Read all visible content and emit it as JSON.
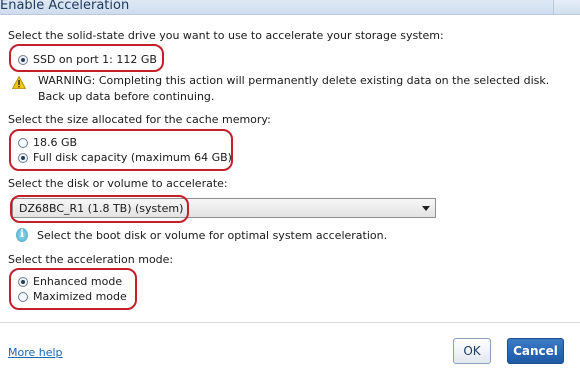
{
  "window": {
    "title": "Enable Acceleration"
  },
  "ssd_section": {
    "label": "Select the solid-state drive you want to use to accelerate your storage system:",
    "option": "SSD on port 1: 112 GB"
  },
  "warning": {
    "icon": "warning-triangle-icon",
    "text": "WARNING: Completing this action will permanently delete existing data on the selected disk. Back up data before continuing."
  },
  "cache_section": {
    "label": "Select the size allocated for the cache memory:",
    "options": [
      "18.6 GB",
      "Full disk capacity (maximum 64 GB)"
    ],
    "selected": 1
  },
  "disk_section": {
    "label": "Select the disk or volume to accelerate:",
    "selected_value": "DZ68BC_R1 (1.8 TB) (system)",
    "hint": "Select the boot disk or volume for optimal system acceleration."
  },
  "mode_section": {
    "label": "Select the acceleration mode:",
    "options": [
      "Enhanced mode",
      "Maximized mode"
    ],
    "selected": 0
  },
  "footer": {
    "help_link": "More help",
    "ok_label": "OK",
    "cancel_label": "Cancel"
  },
  "colors": {
    "highlight": "#c3202a",
    "link": "#1a66b3",
    "primary_button": "#1d5aa6"
  }
}
